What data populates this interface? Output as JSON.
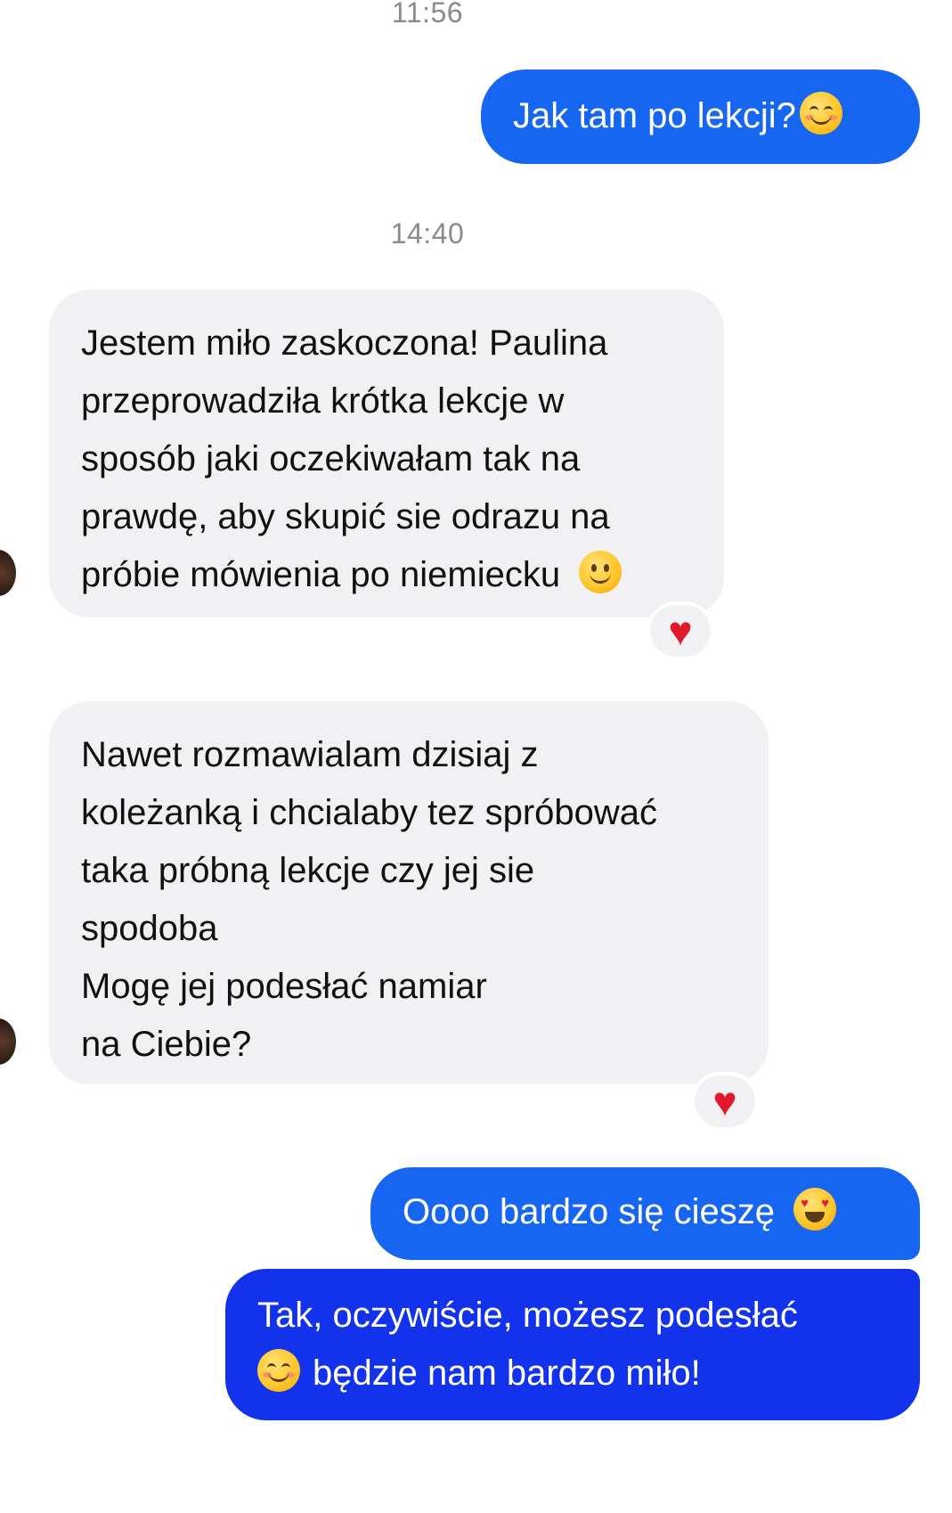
{
  "conversation": {
    "timestamps": [
      "11:56",
      "14:40"
    ],
    "messages": [
      {
        "direction": "outgoing",
        "lines": [
          "Jak tam po lekcji?"
        ],
        "emoji": "relieved-smile-emoji"
      },
      {
        "direction": "incoming",
        "lines": [
          "Jestem miło zaskoczona! Paulina",
          "przeprowadziła krótka lekcje w",
          "sposób jaki oczekiwałam tak na",
          "prawdę, aby skupić sie odrazu na",
          "próbie mówienia po niemiecku"
        ],
        "emoji": "slight-smile-emoji",
        "reaction": "♥"
      },
      {
        "direction": "incoming",
        "lines": [
          "Nawet rozmawialam dzisiaj z",
          "koleżanką i chcialaby tez spróbować",
          "taka próbną lekcje czy jej sie",
          "spodoba",
          "Mogę jej podesłać namiar",
          "na Ciebie?"
        ],
        "reaction": "♥"
      },
      {
        "direction": "outgoing",
        "lines": [
          "Oooo bardzo się cieszę"
        ],
        "emoji": "heart-eyes-emoji"
      },
      {
        "direction": "outgoing",
        "lines": [
          "Tak, oczywiście, możesz podesłać",
          "będzie nam bardzo miło!"
        ],
        "emoji": "smiling-eyes-emoji"
      }
    ]
  },
  "colors": {
    "outgoing_bubble": "#1766f2",
    "outgoing_bubble_deep": "#1232ec",
    "incoming_bubble": "#f1f1f4",
    "timestamp_text": "#8a8a8e",
    "reaction_heart": "#e3172b"
  }
}
